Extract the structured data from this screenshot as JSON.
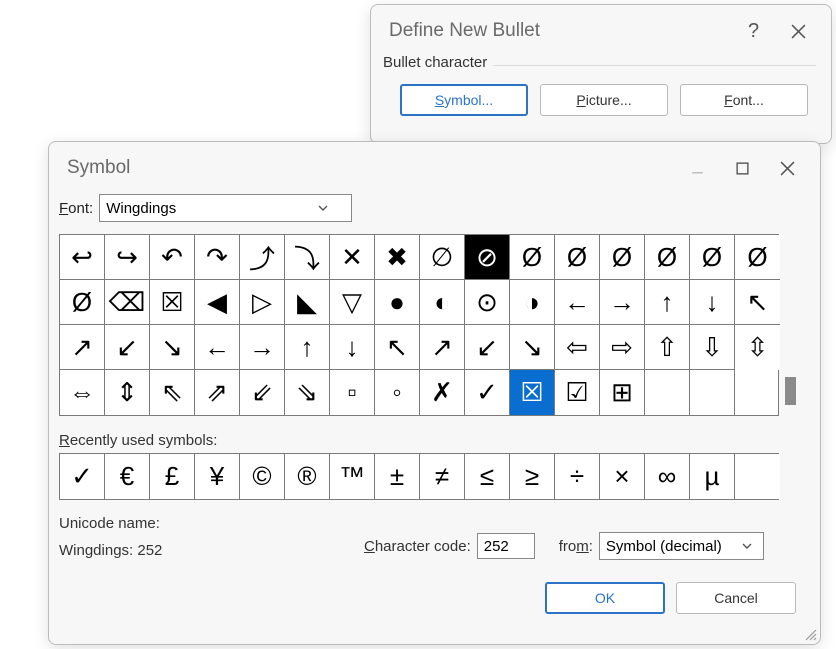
{
  "bullet_dialog": {
    "title": "Define New Bullet",
    "group_label": "Bullet character",
    "buttons": {
      "symbol": "Symbol...",
      "picture": "Picture...",
      "font": "Font..."
    }
  },
  "symbol_dialog": {
    "title": "Symbol",
    "font_label": "Font:",
    "font_value": "Wingdings",
    "grid": {
      "cols": 16,
      "rows": 4,
      "selected_index": 58,
      "blackbg_index": 9,
      "glyphs": [
        "↩",
        "↪",
        "↶",
        "↷",
        "⤴",
        "⤵",
        "✕",
        "✖",
        "∅",
        "⊘",
        "Ø",
        "Ø",
        "Ø",
        "Ø",
        "Ø",
        "Ø",
        "Ø",
        "⌫",
        "☒",
        "◀",
        "▷",
        "◣",
        "▽",
        "●",
        "◐",
        "⊙",
        "◑",
        "←",
        "→",
        "↑",
        "↓",
        "↖",
        "↗",
        "↙",
        "↘",
        "←",
        "→",
        "↑",
        "↓",
        "↖",
        "↗",
        "↙",
        "↘",
        "⇦",
        "⇨",
        "⇧",
        "⇩",
        "⇳",
        "⇔",
        "⇕",
        "⇖",
        "⇗",
        "⇙",
        "⇘",
        "▫",
        "◦",
        "✗",
        "✓",
        "☒",
        "☑",
        "⊞",
        "",
        ""
      ]
    },
    "recent_label": "Recently used symbols:",
    "recent": [
      "✓",
      "€",
      "£",
      "¥",
      "©",
      "®",
      "™",
      "±",
      "≠",
      "≤",
      "≥",
      "÷",
      "×",
      "∞",
      "µ",
      ""
    ],
    "unicode_name_label": "Unicode name:",
    "unicode_name_value": "Wingdings: 252",
    "charcode_label": "Character code:",
    "charcode_value": "252",
    "from_label": "from:",
    "from_value": "Symbol (decimal)",
    "ok": "OK",
    "cancel": "Cancel"
  }
}
